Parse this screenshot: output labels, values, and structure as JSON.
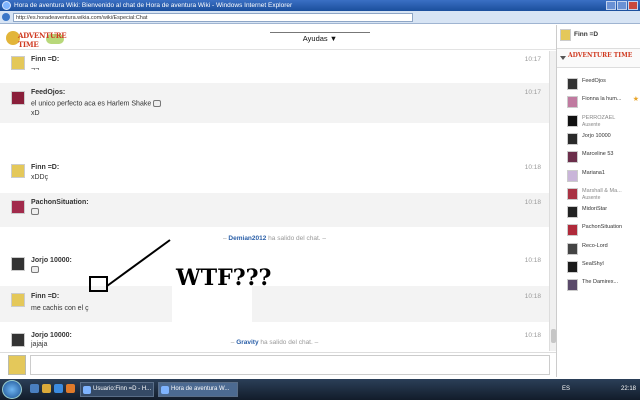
{
  "window": {
    "title": "Hora de aventura Wiki: Bienvenido al chat de Hora de aventura Wiki - Windows Internet Explorer",
    "url": "http://es.horadeaventura.wikia.com/wiki/Especial:Chat"
  },
  "header": {
    "logo_text": "ADVENTURE TIME",
    "menu_label": "Ayudas ▼"
  },
  "messages": [
    {
      "user": "Finn =D:",
      "lines": [
        "¬¬"
      ],
      "time": "10:17",
      "alt": false
    },
    {
      "user": "FeedOjos:",
      "lines": [
        "el unico perfecto aca es Harlem Shake",
        "xD"
      ],
      "time": "10:17",
      "alt": true
    },
    {
      "user": "Finn =D:",
      "lines": [
        "xDDç"
      ],
      "time": "10:18",
      "alt": false
    },
    {
      "user": "PachonSituation:",
      "lines": [
        ""
      ],
      "time": "10:18",
      "alt": true
    },
    {
      "user": "Jorjo 10000:",
      "lines": [
        ""
      ],
      "time": "10:18",
      "alt": false
    },
    {
      "user": "Finn =D:",
      "lines": [
        "me cachis con el ç"
      ],
      "time": "10:18",
      "alt": true
    },
    {
      "user": "Jorjo 10000:",
      "lines": [
        "jajaja"
      ],
      "time": "10:18",
      "alt": false
    }
  ],
  "inform": [
    {
      "user": "Demian2012",
      "suffix": " ha salido del chat. –",
      "prefix": "– "
    },
    {
      "user": "Gravity",
      "suffix": " ha salido del chat. –",
      "prefix": "– "
    }
  ],
  "annotation": {
    "text": "WTF???"
  },
  "sidebar": {
    "me_name": "Finn =D",
    "wiki_logo": "ADVENTURE TIME",
    "users": [
      {
        "name": "FeedOjos",
        "sub": "",
        "away": false,
        "star": false
      },
      {
        "name": "Fionna la hum...",
        "sub": "",
        "away": false,
        "star": true
      },
      {
        "name": "PERROZAEL",
        "sub": "Ausente",
        "away": true,
        "star": false
      },
      {
        "name": "Jorjo 10000",
        "sub": "",
        "away": false,
        "star": false
      },
      {
        "name": "Marceline 53",
        "sub": "",
        "away": false,
        "star": false
      },
      {
        "name": "Mariana1",
        "sub": "",
        "away": false,
        "star": false
      },
      {
        "name": "Marshall & Ma...",
        "sub": "Ausente",
        "away": true,
        "star": false
      },
      {
        "name": "MidoriStar",
        "sub": "",
        "away": false,
        "star": false
      },
      {
        "name": "PachonSituation",
        "sub": "",
        "away": false,
        "star": false
      },
      {
        "name": "Reco-Lord",
        "sub": "",
        "away": false,
        "star": false
      },
      {
        "name": "SealShyl",
        "sub": "",
        "away": false,
        "star": false
      },
      {
        "name": "The Damirex...",
        "sub": "",
        "away": false,
        "star": false
      }
    ]
  },
  "taskbar": {
    "tasks": [
      "Usuario:Finn =D - H...",
      "Hora de aventura W..."
    ],
    "lang": "ES",
    "clock": "22:18"
  },
  "colors": {
    "titlebar": "#1b4f9c",
    "inform_user": "#2a5fa8",
    "logo": "#d03b22",
    "star": "#e8a52a"
  }
}
